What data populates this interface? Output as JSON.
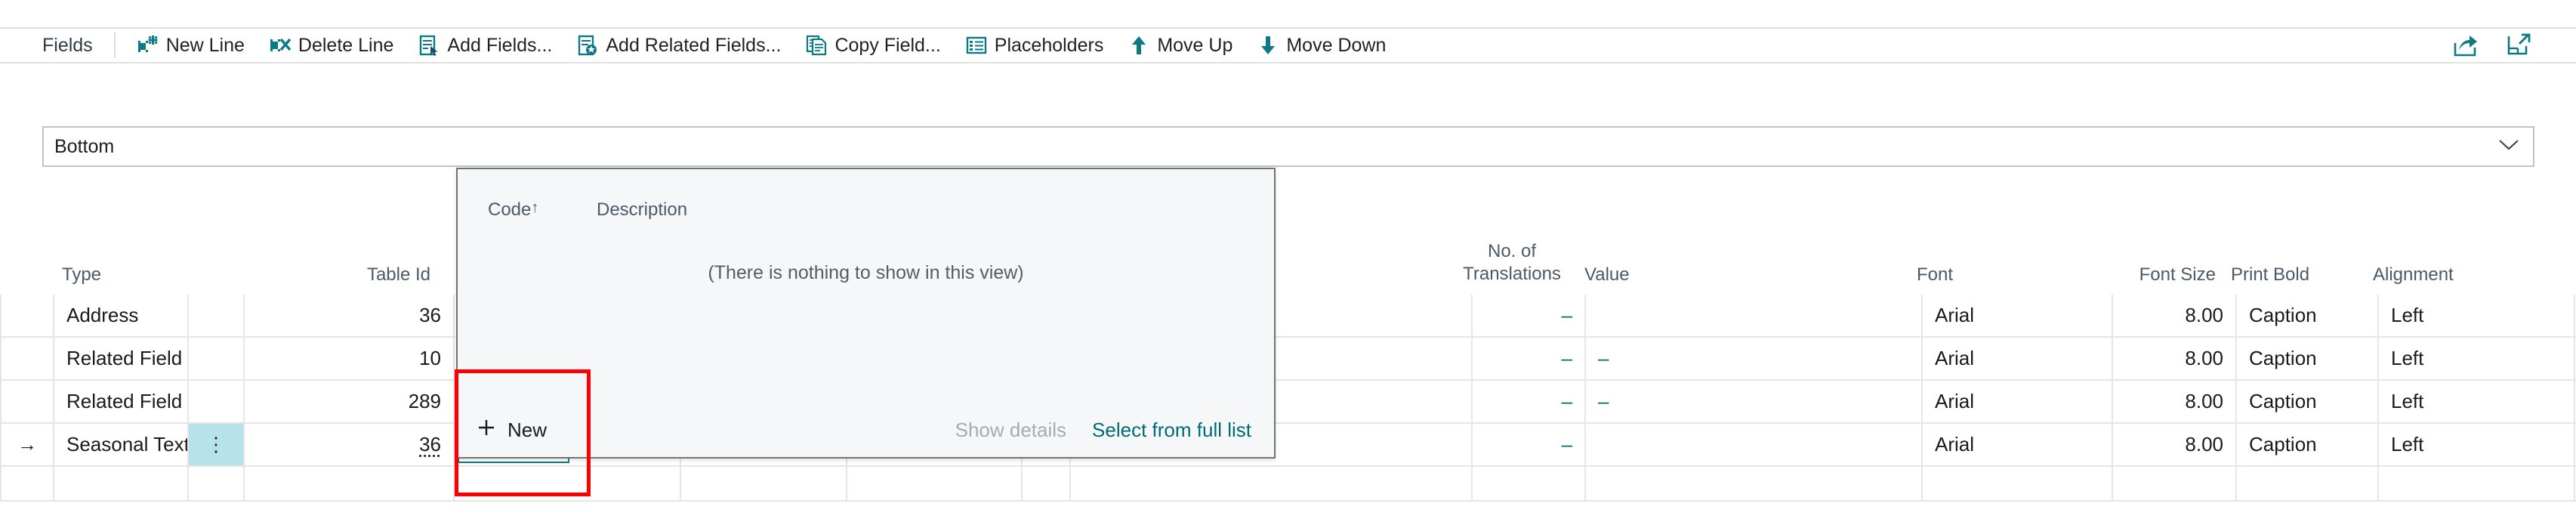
{
  "toolbar": {
    "title": "Fields",
    "buttons": [
      {
        "label": "New Line",
        "icon": "new-line-icon"
      },
      {
        "label": "Delete Line",
        "icon": "delete-line-icon"
      },
      {
        "label": "Add Fields...",
        "icon": "add-fields-icon"
      },
      {
        "label": "Add Related Fields...",
        "icon": "add-related-fields-icon"
      },
      {
        "label": "Copy Field...",
        "icon": "copy-field-icon"
      },
      {
        "label": "Placeholders",
        "icon": "placeholders-icon"
      },
      {
        "label": "Move Up",
        "icon": "arrow-up-icon"
      },
      {
        "label": "Move Down",
        "icon": "arrow-down-icon"
      }
    ],
    "right_icons": [
      {
        "name": "share-icon"
      },
      {
        "name": "open-in-new-window-icon"
      }
    ]
  },
  "filter_select": {
    "value": "Bottom",
    "chevron": "chevron-down-icon"
  },
  "grid": {
    "columns": [
      {
        "key": "indicator",
        "label": "",
        "align": "center"
      },
      {
        "key": "type",
        "label": "Type",
        "align": "left"
      },
      {
        "key": "menu",
        "label": "",
        "align": "center"
      },
      {
        "key": "table_id",
        "label": "Table Id",
        "align": "right"
      },
      {
        "key": "field_no",
        "label": "",
        "align": "left"
      },
      {
        "key": "col_e",
        "label": "",
        "align": "right"
      },
      {
        "key": "col_f",
        "label": "",
        "align": "right"
      },
      {
        "key": "check",
        "label": "",
        "align": "center"
      },
      {
        "key": "col_h",
        "label": "",
        "align": "left"
      },
      {
        "key": "translations",
        "label": "No. of Translations",
        "align": "right"
      },
      {
        "key": "value",
        "label": "Value",
        "align": "left"
      },
      {
        "key": "font",
        "label": "Font",
        "align": "left"
      },
      {
        "key": "font_size",
        "label": "Font Size",
        "align": "right"
      },
      {
        "key": "print_bold",
        "label": "Print Bold",
        "align": "left"
      },
      {
        "key": "alignment",
        "label": "Alignment",
        "align": "left"
      }
    ],
    "rows": [
      {
        "indicator": "",
        "type": "Address",
        "menu": "",
        "table_id": "36",
        "table_id_underline": false,
        "selected_menu_cell": false,
        "col_e": "",
        "col_f": "",
        "check": false,
        "translations": "dash",
        "value": "",
        "font": "Arial",
        "font_size": "8.00",
        "print_bold": "Caption",
        "alignment": "Left",
        "editing": false,
        "active": false
      },
      {
        "indicator": "",
        "type": "Related Field",
        "menu": "",
        "table_id": "10",
        "table_id_underline": false,
        "selected_menu_cell": false,
        "col_e": "",
        "col_f": "",
        "check": false,
        "translations": "dash",
        "value": "dash",
        "font": "Arial",
        "font_size": "8.00",
        "print_bold": "Caption",
        "alignment": "Left",
        "editing": false,
        "active": false
      },
      {
        "indicator": "",
        "type": "Related Field",
        "menu": "",
        "table_id": "289",
        "table_id_underline": false,
        "selected_menu_cell": false,
        "col_e": "",
        "col_f": "",
        "check": false,
        "translations": "dash",
        "value": "dash",
        "font": "Arial",
        "font_size": "8.00",
        "print_bold": "Caption",
        "alignment": "Left",
        "editing": false,
        "active": false
      },
      {
        "indicator": "→",
        "type": "Seasonal Text",
        "menu": "⋮",
        "table_id": "36",
        "table_id_underline": true,
        "selected_menu_cell": true,
        "col_e": "dash",
        "col_f": "dash",
        "check": true,
        "translations": "dash",
        "value": "",
        "font": "Arial",
        "font_size": "8.00",
        "print_bold": "Caption",
        "alignment": "Left",
        "editing": true,
        "active": true
      }
    ],
    "editing_cell": {
      "text": "",
      "chevron": "chevron-down-icon",
      "ellipsis_label": "…",
      "assist_edit_name": "assist-edit-button"
    }
  },
  "dropdown_popup": {
    "headers": [
      {
        "label": "Code",
        "sort_arrow": "↑"
      },
      {
        "label": "Description",
        "sort_arrow": ""
      }
    ],
    "empty_message": "(There is nothing to show in this view)",
    "footer": {
      "new_label": "New",
      "new_icon": "plus-icon",
      "show_details_label": "Show details",
      "select_full_list_label": "Select from full list"
    }
  },
  "colors": {
    "accent_teal": "#006b75",
    "icon_teal": "#0c7a85",
    "selection_cyan": "#b6e3e9",
    "highlight_red": "#ff0000",
    "header_text": "#4b5a6b",
    "popup_bg": "#f5f7f8",
    "checkbox_gray": "#6e6e6e"
  }
}
